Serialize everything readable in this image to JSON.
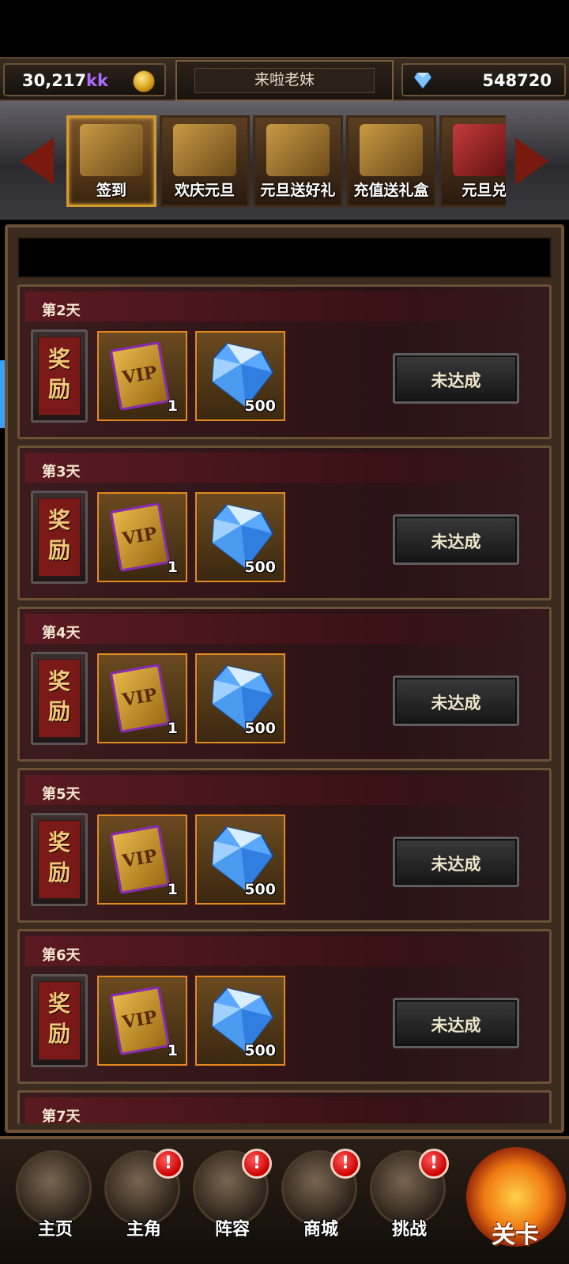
{
  "topbar": {
    "gold_value": "30,217",
    "gold_unit": "kk",
    "player_name": "来啦老妹",
    "diamond_value": "548720"
  },
  "tabs": [
    {
      "label": "签到",
      "active": true
    },
    {
      "label": "欢庆元旦",
      "active": false
    },
    {
      "label": "元旦送好礼",
      "active": false
    },
    {
      "label": "充值送礼盒",
      "active": false
    },
    {
      "label": "元旦兑",
      "active": false
    }
  ],
  "reward_tag_label": "奖励",
  "reward_tag_line1": "奖",
  "reward_tag_line2": "励",
  "rows": [
    {
      "day": "第2天",
      "vip_qty": "1",
      "gem_qty": "500",
      "status": "未达成"
    },
    {
      "day": "第3天",
      "vip_qty": "1",
      "gem_qty": "500",
      "status": "未达成"
    },
    {
      "day": "第4天",
      "vip_qty": "1",
      "gem_qty": "500",
      "status": "未达成"
    },
    {
      "day": "第5天",
      "vip_qty": "1",
      "gem_qty": "500",
      "status": "未达成"
    },
    {
      "day": "第6天",
      "vip_qty": "1",
      "gem_qty": "500",
      "status": "未达成"
    },
    {
      "day": "第7天"
    }
  ],
  "vip_card_text": "VIP",
  "bottom_nav": [
    {
      "label": "主页",
      "icon": "castle-icon",
      "badge": false
    },
    {
      "label": "主角",
      "icon": "hero-icon",
      "badge": true
    },
    {
      "label": "阵容",
      "icon": "formation-icon",
      "badge": true
    },
    {
      "label": "商城",
      "icon": "treasure-chest-icon",
      "badge": true
    },
    {
      "label": "挑战",
      "icon": "swords-icon",
      "badge": true
    }
  ],
  "badge_text": "!",
  "stage_label": "关卡",
  "colors": {
    "accent_gold": "#e28a1e",
    "badge_red": "#cc0000",
    "bubble_blue": "#3ea0f5",
    "kk_purple": "#b06cff"
  }
}
